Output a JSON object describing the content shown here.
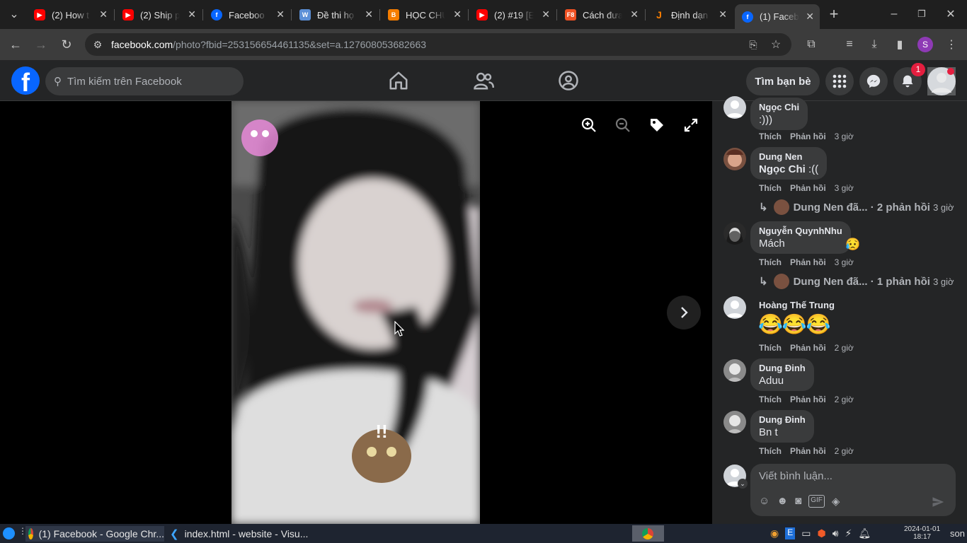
{
  "tabs": [
    {
      "title": "(2) How t",
      "icon": "youtube-icon"
    },
    {
      "title": "(2) Ship p",
      "icon": "youtube-icon"
    },
    {
      "title": "Faceboo",
      "icon": "facebook-icon"
    },
    {
      "title": "Đề thi họ",
      "icon": "document-icon"
    },
    {
      "title": "HỌC CHU",
      "icon": "blogger-icon"
    },
    {
      "title": "(2) #19 [E",
      "icon": "youtube-icon"
    },
    {
      "title": "Cách đưa",
      "icon": "f8-icon"
    },
    {
      "title": "Định dạn",
      "icon": "java-icon"
    },
    {
      "title": "(1) Faceb",
      "icon": "facebook-icon"
    }
  ],
  "address": {
    "host": "facebook.com",
    "path": "/photo?fbid=253156654461135&set=a.127608053682663"
  },
  "header": {
    "search_placeholder": "Tìm kiếm trên Facebook",
    "find_friends": "Tìm bạn bè",
    "notification_count": "1",
    "logo": "f"
  },
  "comments": [
    {
      "name": "Ngọc Chi",
      "text": ":)))",
      "like": "Thích",
      "reply": "Phản hồi",
      "time": "3 giờ"
    },
    {
      "name": "Dung Nen",
      "mention": "Ngọc Chi",
      "text": " :((",
      "like": "Thích",
      "reply": "Phản hồi",
      "time": "3 giờ"
    },
    {
      "name": "Nguyễn QuynhNhu",
      "text": "Mách",
      "reaction": "😥",
      "like": "Thích",
      "reply": "Phản hồi",
      "time": "3 giờ"
    },
    {
      "name": "Hoàng Thế Trung",
      "text": "😂😂😂",
      "like": "Thích",
      "reply": "Phản hồi",
      "time": "2 giờ"
    },
    {
      "name": "Dung Đinh",
      "text": "Aduu",
      "like": "Thích",
      "reply": "Phản hồi",
      "time": "2 giờ"
    },
    {
      "name": "Dung Đinh",
      "text": "Bn t",
      "like": "Thích",
      "reply": "Phản hồi",
      "time": "2 giờ"
    }
  ],
  "reply_threads": [
    {
      "author": "Dung Nen đã...",
      "count": "· 2 phản hồi",
      "time": "3 giờ"
    },
    {
      "author": "Dung Nen đã...",
      "count": "· 1 phản hồi",
      "time": "3 giờ"
    }
  ],
  "composer": {
    "placeholder": "Viết bình luận..."
  },
  "taskbar": {
    "task1": "(1) Facebook - Google Chr...",
    "task2": "index.html - website - Visu...",
    "date": "2024-01-01",
    "time": "18:17",
    "user": "son"
  }
}
